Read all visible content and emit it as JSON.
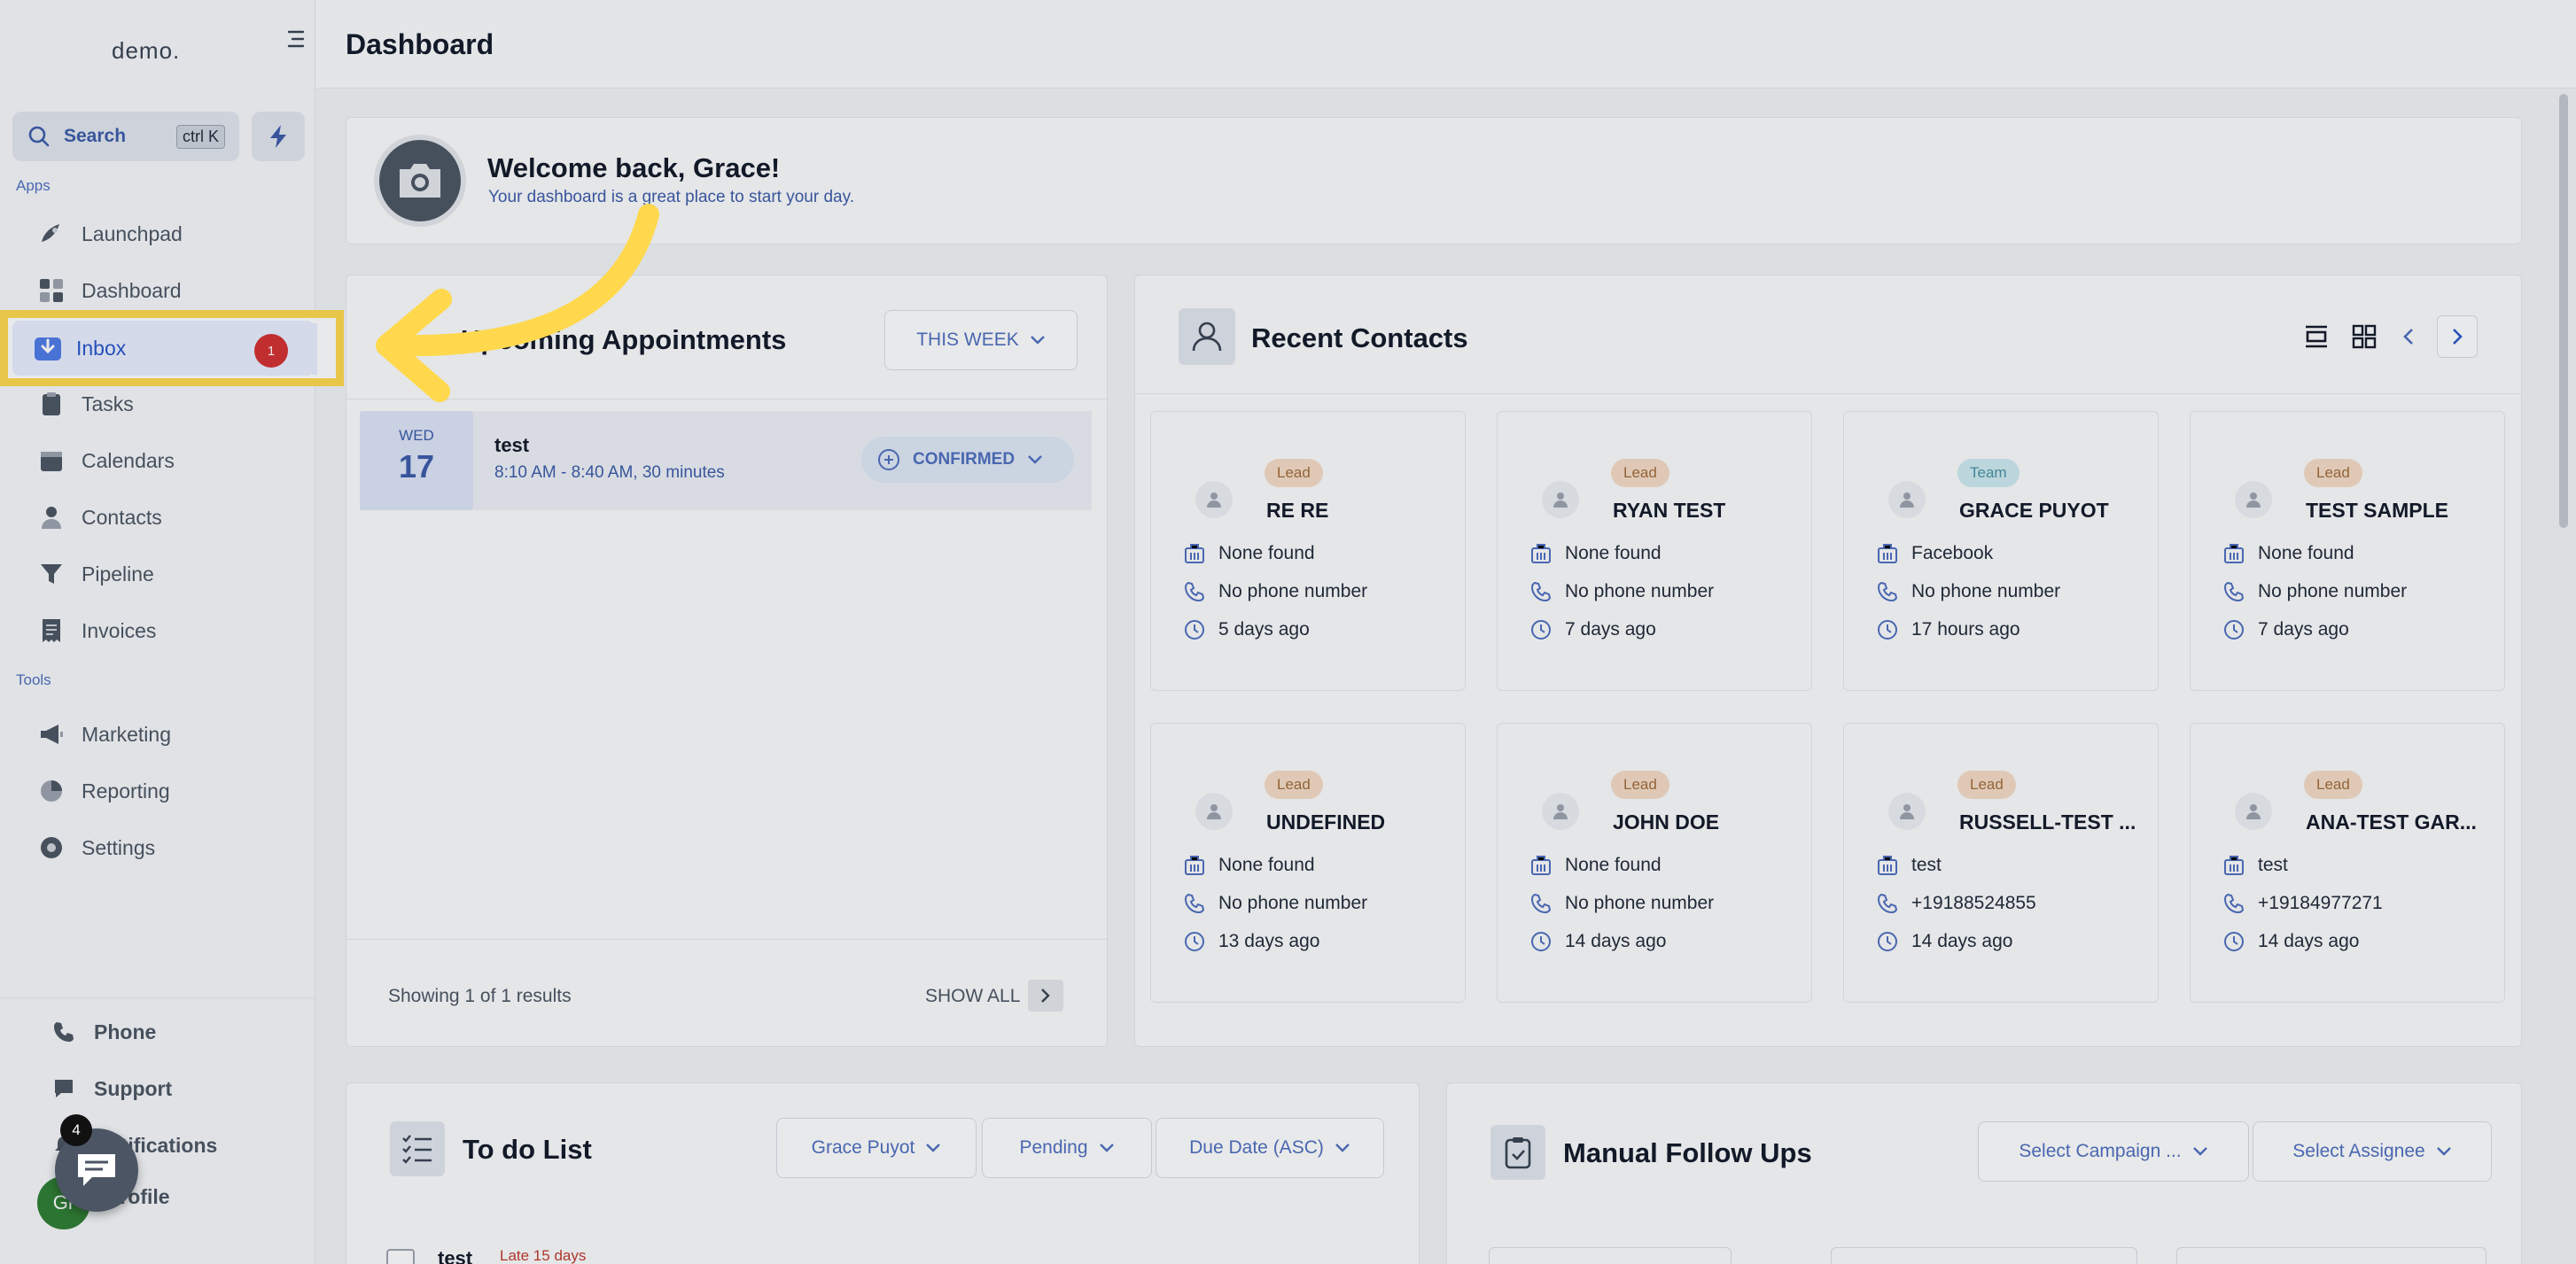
{
  "sidebar": {
    "logo": "demo.",
    "search_label": "Search",
    "search_shortcut": "ctrl K",
    "apps_label": "Apps",
    "tools_label": "Tools",
    "items": [
      {
        "label": "Launchpad"
      },
      {
        "label": "Dashboard"
      },
      {
        "label": "Inbox",
        "badge": "1"
      },
      {
        "label": "Tasks"
      },
      {
        "label": "Calendars"
      },
      {
        "label": "Contacts"
      },
      {
        "label": "Pipeline"
      },
      {
        "label": "Invoices"
      }
    ],
    "tools": [
      {
        "label": "Marketing"
      },
      {
        "label": "Reporting"
      },
      {
        "label": "Settings"
      }
    ],
    "bottom": [
      {
        "label": "Phone"
      },
      {
        "label": "Support"
      },
      {
        "label": "Notifications"
      },
      {
        "label": "Profile"
      }
    ],
    "chat_count": "4",
    "profile_initials": "Gr"
  },
  "header": {
    "title": "Dashboard"
  },
  "welcome": {
    "title": "Welcome back, Grace!",
    "subtitle": "Your dashboard is a great place to start your day."
  },
  "appointments": {
    "title": "Upcoming Appointments",
    "filter": "THIS WEEK",
    "item": {
      "dow": "WED",
      "day": "17",
      "title": "test",
      "time": "8:10 AM - 8:40 AM, 30 minutes",
      "status": "CONFIRMED"
    },
    "showing": "Showing 1 of 1 results",
    "show_all": "SHOW ALL"
  },
  "recent_contacts": {
    "title": "Recent Contacts",
    "contacts": [
      {
        "tag": "Lead",
        "name": "RE RE",
        "company": "None found",
        "phone": "No phone number",
        "time": "5 days ago"
      },
      {
        "tag": "Lead",
        "name": "RYAN TEST",
        "company": "None found",
        "phone": "No phone number",
        "time": "7 days ago"
      },
      {
        "tag": "Team",
        "name": "GRACE PUYOT",
        "company": "Facebook",
        "phone": "No phone number",
        "time": "17 hours ago"
      },
      {
        "tag": "Lead",
        "name": "TEST SAMPLE",
        "company": "None found",
        "phone": "No phone number",
        "time": "7 days ago"
      },
      {
        "tag": "Lead",
        "name": "UNDEFINED",
        "company": "None found",
        "phone": "No phone number",
        "time": "13 days ago"
      },
      {
        "tag": "Lead",
        "name": "JOHN DOE",
        "company": "None found",
        "phone": "No phone number",
        "time": "14 days ago"
      },
      {
        "tag": "Lead",
        "name": "RUSSELL-TEST ...",
        "company": "test",
        "phone": "+19188524855",
        "time": "14 days ago"
      },
      {
        "tag": "Lead",
        "name": "ANA-TEST GAR...",
        "company": "test",
        "phone": "+19184977271",
        "time": "14 days ago"
      }
    ]
  },
  "todo": {
    "title": "To do List",
    "filters": [
      "Grace Puyot",
      "Pending",
      "Due Date (ASC)"
    ],
    "item": {
      "title": "test",
      "late": "Late 15 days"
    }
  },
  "follow_ups": {
    "title": "Manual Follow Ups",
    "filters": [
      "Select Campaign ...",
      "Select Assignee"
    ]
  },
  "colors": {
    "accent": "#3b5ba9",
    "highlight": "#ffd84d",
    "badge": "#d32f2f"
  }
}
